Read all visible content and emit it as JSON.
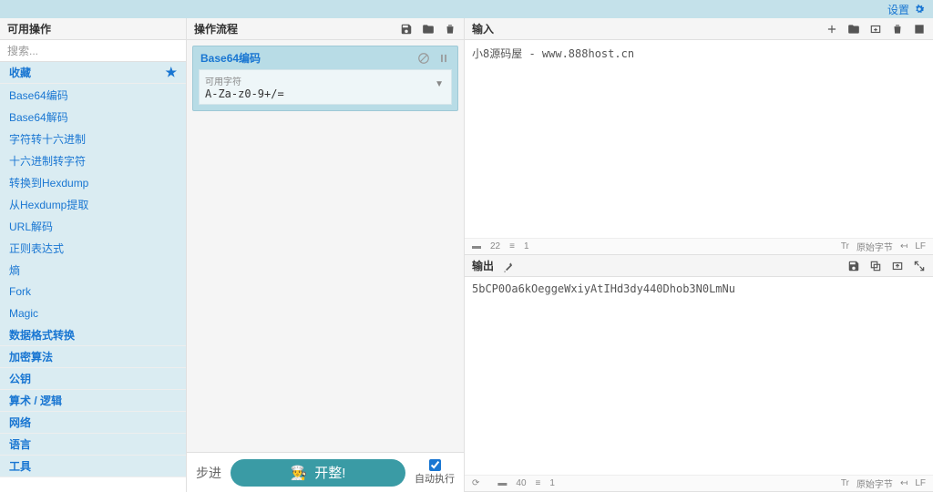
{
  "topbar": {
    "settings_label": "设置"
  },
  "sidebar": {
    "title": "可用操作",
    "search_placeholder": "搜索...",
    "categories": [
      {
        "label": "收藏",
        "open": true,
        "starred": true
      },
      {
        "label": "数据格式转换"
      },
      {
        "label": "加密算法"
      },
      {
        "label": "公钥"
      },
      {
        "label": "算术 / 逻辑"
      },
      {
        "label": "网络"
      },
      {
        "label": "语言"
      },
      {
        "label": "工具"
      }
    ],
    "fav_ops": [
      {
        "label": "Base64编码"
      },
      {
        "label": "Base64解码"
      },
      {
        "label": "字符转十六进制"
      },
      {
        "label": "十六进制转字符"
      },
      {
        "label": "转换到Hexdump"
      },
      {
        "label": "从Hexdump提取"
      },
      {
        "label": "URL解码"
      },
      {
        "label": "正则表达式"
      },
      {
        "label": "熵"
      },
      {
        "label": "Fork"
      },
      {
        "label": "Magic"
      }
    ]
  },
  "recipe": {
    "title": "操作流程",
    "items": [
      {
        "name": "Base64编码",
        "arg_label": "可用字符",
        "arg_value": "A-Za-z0-9+/="
      }
    ],
    "step_label": "步进",
    "bake_label": "开整!",
    "autobake_label": "自动执行"
  },
  "input": {
    "title": "输入",
    "text": "小8源码屋 - www.888host.cn",
    "status": {
      "bytes": "22",
      "lines": "1",
      "enc": "原始字节",
      "eol": "LF"
    }
  },
  "output": {
    "title": "输出",
    "text": "5bCP0Oa6kOeggeWxiyAtIHd3dy440Dhob3N0LmNu",
    "status": {
      "time": "",
      "bytes": "40",
      "lines": "1",
      "enc": "原始字节",
      "eol": "LF"
    }
  }
}
